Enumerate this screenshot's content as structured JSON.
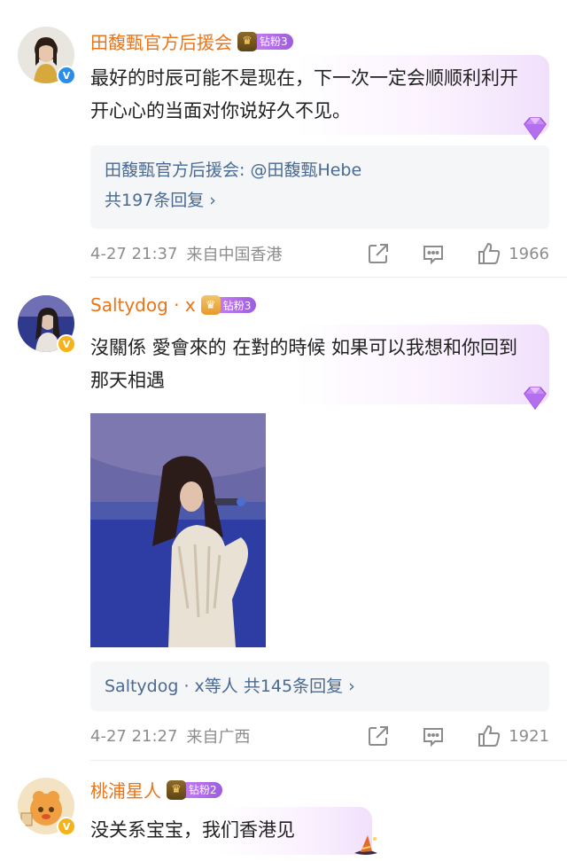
{
  "comments": [
    {
      "username": "田馥甄官方后援会",
      "fan_level": "钻粉3",
      "text": "最好的时辰可能不是现在，下一次一定会顺顺利利开开心心的当面对你说好久不见。",
      "reply_preview": "田馥甄官方后援会: @田馥甄Hebe",
      "reply_total": "共197条回复 ›",
      "time": "4-27 21:37",
      "location": "来自中国香港",
      "likes": "1966"
    },
    {
      "username": "Saltydog · x",
      "fan_level": "钻粉3",
      "text": "沒關係 愛會來的 在對的時候 如果可以我想和你回到那天相遇",
      "reply_total": "Saltydog · x等人  共145条回复 ›",
      "time": "4-27 21:27",
      "location": "来自广西",
      "likes": "1921"
    },
    {
      "username": "桃浦星人",
      "fan_level": "钻粉2",
      "text": "没关系宝宝，我们香港见"
    }
  ],
  "icons": {
    "verified": "verified-v-icon",
    "share": "share-icon",
    "comment": "comment-icon",
    "like": "thumbs-up-icon"
  },
  "colors": {
    "username": "#e8751a",
    "reply_link": "#4a6a92",
    "meta": "#8c8c8c",
    "fan_badge": "#a866e6"
  }
}
